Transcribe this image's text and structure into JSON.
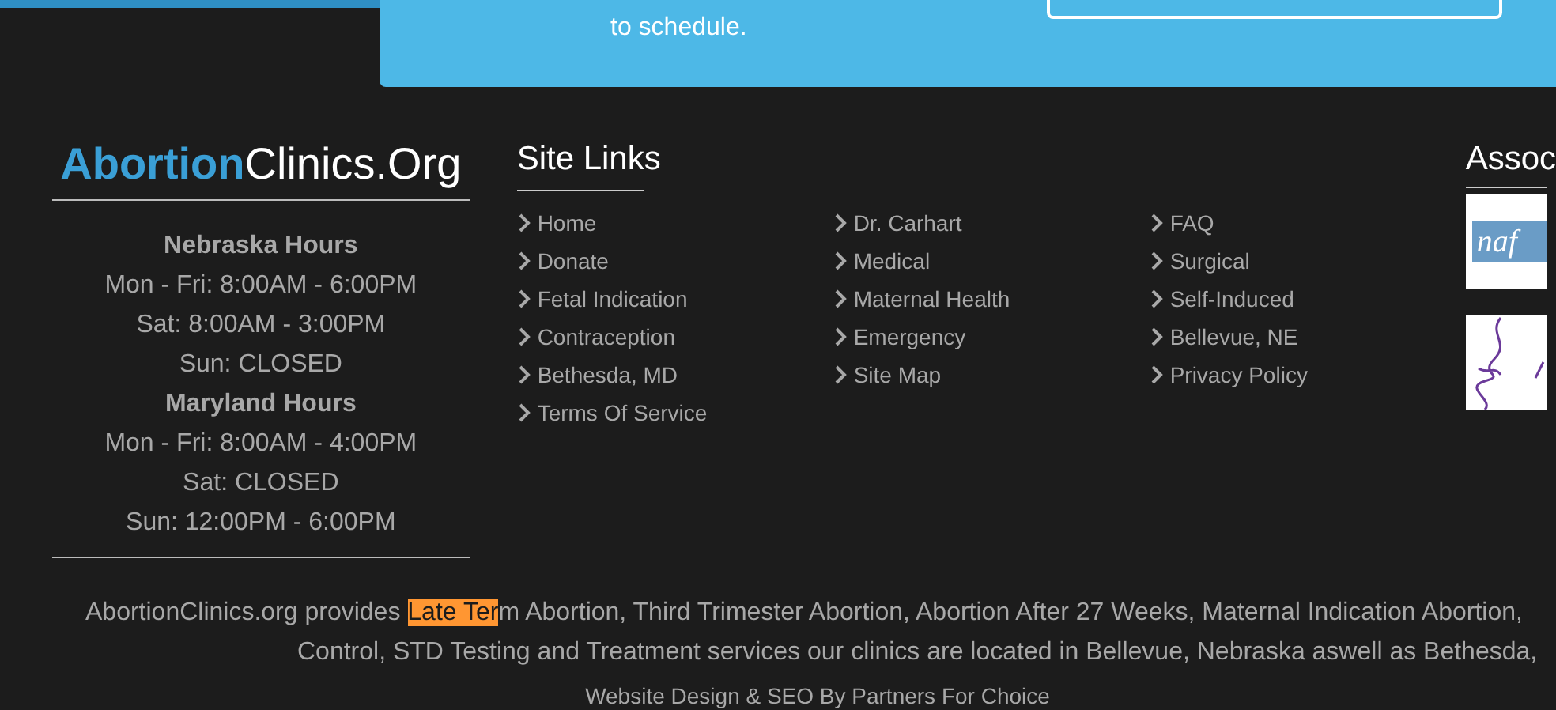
{
  "banner": {
    "text": "to schedule."
  },
  "logo": {
    "part_1": "Abortion",
    "part_2": "Clinics.Org"
  },
  "hours": [
    {
      "kind": "heading",
      "text": "Nebraska Hours"
    },
    {
      "kind": "line",
      "text": "Mon - Fri: 8:00AM - 6:00PM"
    },
    {
      "kind": "line",
      "text": "Sat: 8:00AM - 3:00PM"
    },
    {
      "kind": "line",
      "text": "Sun: CLOSED"
    },
    {
      "kind": "heading",
      "text": "Maryland Hours"
    },
    {
      "kind": "line",
      "text": "Mon - Fri: 8:00AM - 4:00PM"
    },
    {
      "kind": "line",
      "text": "Sat: CLOSED"
    },
    {
      "kind": "line",
      "text": "Sun: 12:00PM - 6:00PM"
    }
  ],
  "site_links": {
    "title": "Site Links",
    "columns": [
      [
        "Home",
        "Donate",
        "Fetal Indication",
        "Contraception",
        "Bethesda, MD",
        "Terms Of Service"
      ],
      [
        "Dr. Carhart",
        "Medical",
        "Maternal Health",
        "Emergency",
        "Site Map"
      ],
      [
        "FAQ",
        "Surgical",
        "Self-Induced",
        "Bellevue, NE",
        "Privacy Policy"
      ]
    ]
  },
  "associations": {
    "title": "Assoc",
    "logos": [
      {
        "kind": "naf",
        "text": "naf"
      },
      {
        "kind": "squiggle"
      }
    ]
  },
  "description": {
    "line_1": {
      "before": "AbortionClinics.org provides ",
      "highlight": "Late Ter",
      "after": "m Abortion, Third Trimester Abortion, Abortion After 27 Weeks, Maternal Indication Abortion,"
    },
    "line_2": "Control, STD Testing and Treatment services our clinics are located in Bellevue, Nebraska aswell as Bethesda,"
  },
  "credit": "Website Design & SEO By Partners For Choice"
}
